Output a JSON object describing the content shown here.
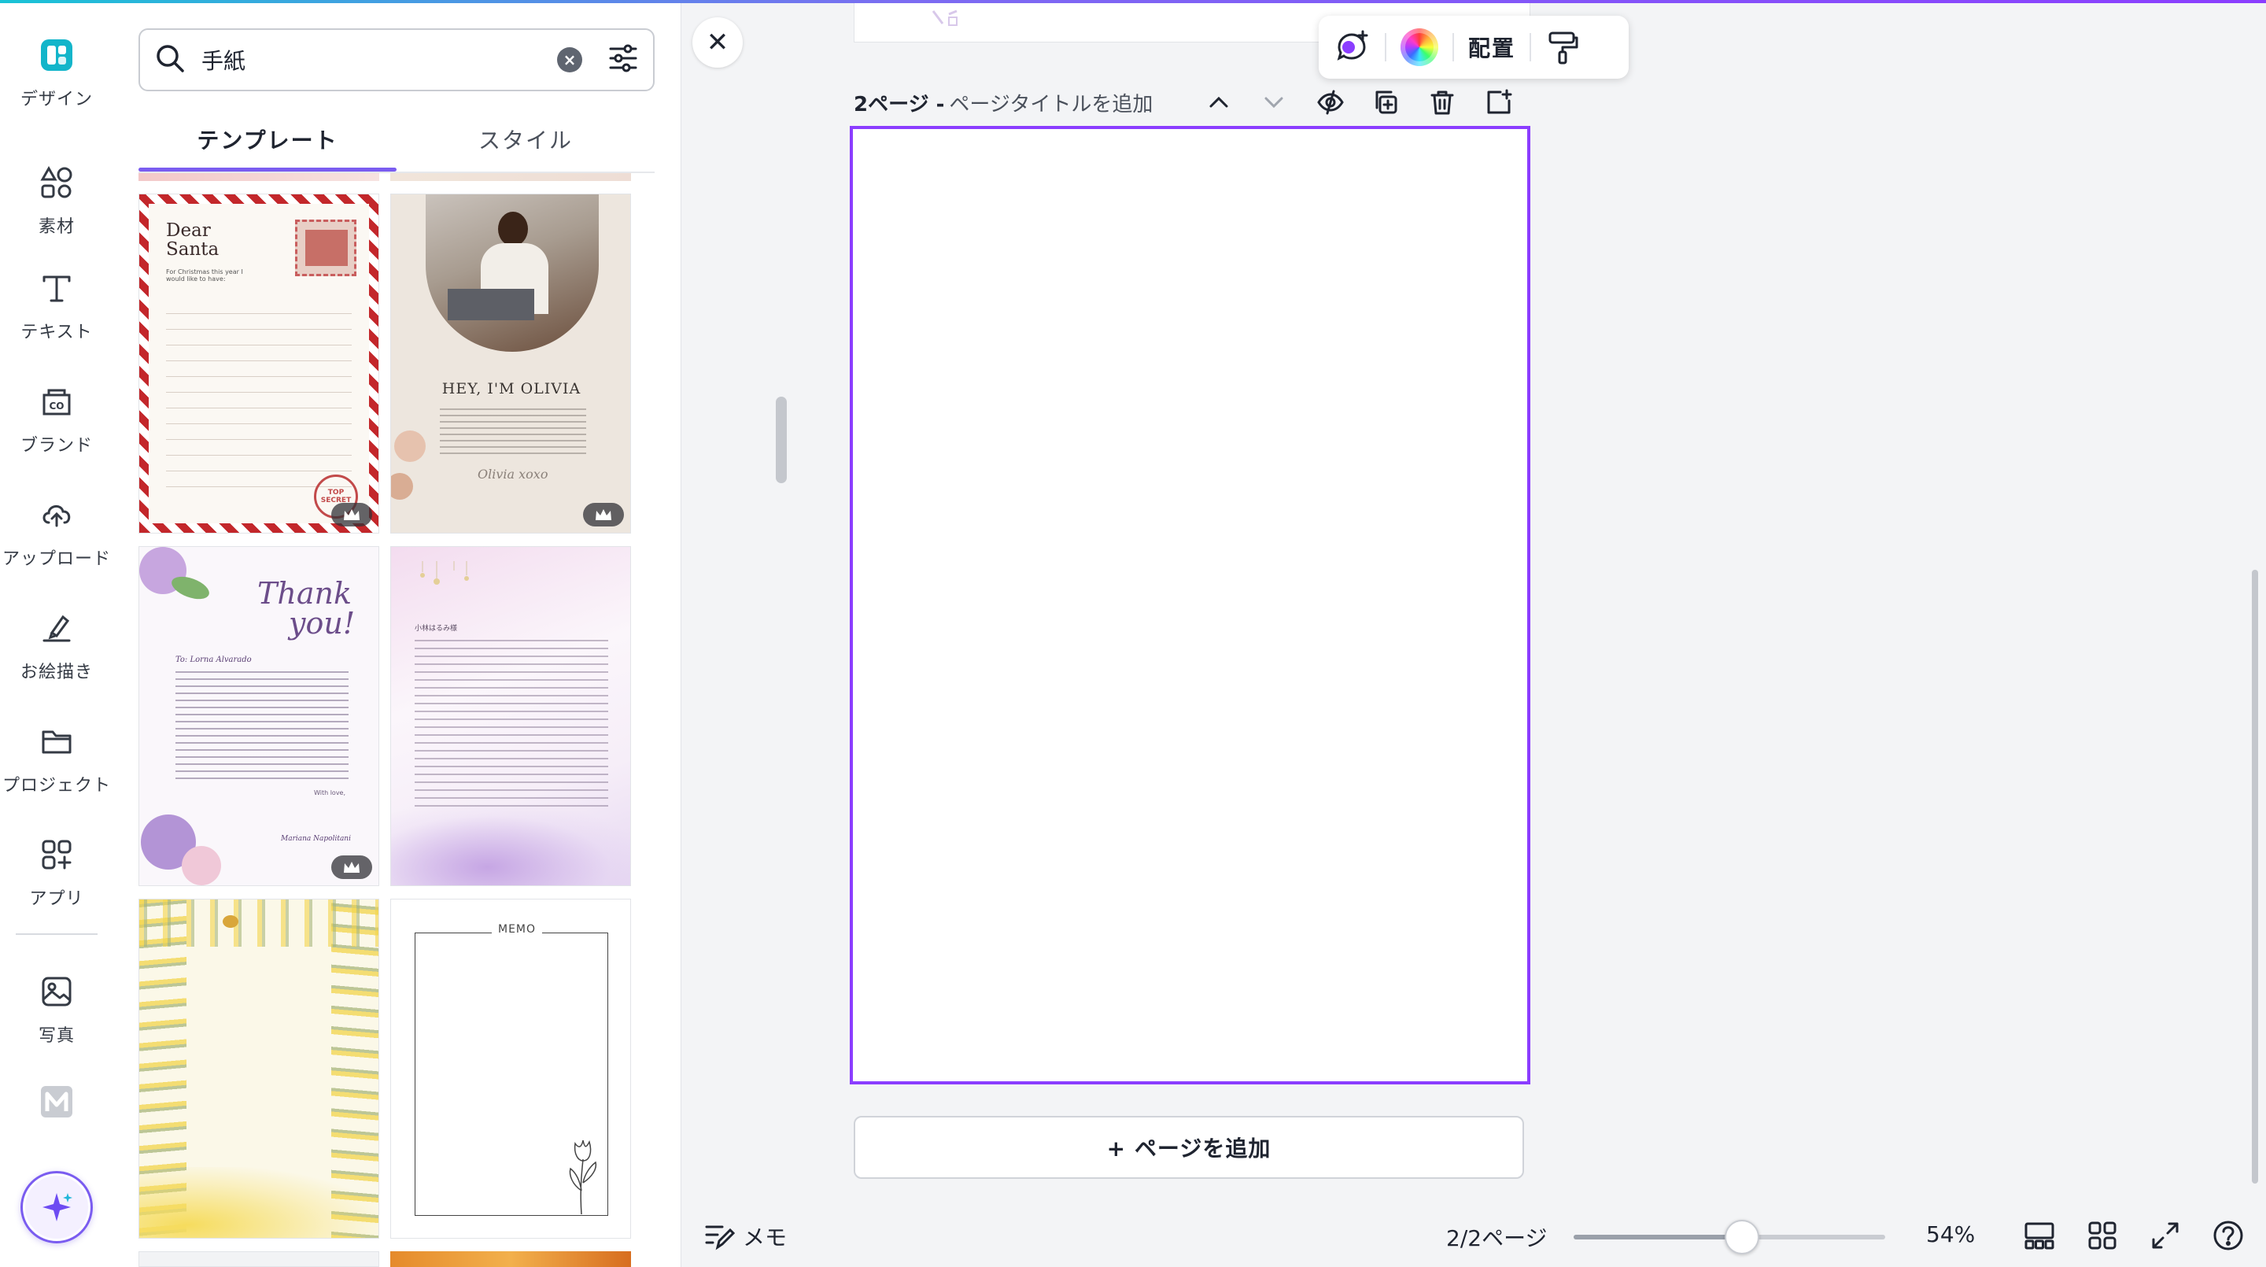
{
  "rail": {
    "items": [
      {
        "label": "デザイン",
        "icon": "design-icon"
      },
      {
        "label": "素材",
        "icon": "elements-icon"
      },
      {
        "label": "テキスト",
        "icon": "text-icon"
      },
      {
        "label": "ブランド",
        "icon": "brand-icon"
      },
      {
        "label": "アップロード",
        "icon": "upload-icon"
      },
      {
        "label": "お絵描き",
        "icon": "draw-icon"
      },
      {
        "label": "プロジェクト",
        "icon": "folder-icon"
      },
      {
        "label": "アプリ",
        "icon": "apps-icon"
      },
      {
        "label": "写真",
        "icon": "photo-icon"
      }
    ],
    "colors": {
      "accent": "#8b3dff",
      "design_tile": "#13b5ca"
    }
  },
  "panel": {
    "search_value": "手紙",
    "tabs": [
      {
        "label": "テンプレート",
        "active": true
      },
      {
        "label": "スタイル",
        "active": false
      }
    ]
  },
  "templates": [
    {
      "name": "dear-santa",
      "title_line1": "Dear",
      "title_line2": "Santa",
      "note": "For Christmas this year I would like to have:",
      "stamp": "TOP SECRET",
      "premium": true
    },
    {
      "name": "hey-im-olivia",
      "title": "HEY, I'M OLIVIA",
      "signature": "Olivia xoxo",
      "premium": true
    },
    {
      "name": "thank-you-floral",
      "title_line1": "Thank",
      "title_line2": "you!",
      "recipient": "To: Lorna Alvarado",
      "closing": "With love,",
      "sender": "Mariana Napolitani",
      "premium": true
    },
    {
      "name": "pastel-letter",
      "greeting": "小林はるみ様",
      "premium": false
    },
    {
      "name": "mimosa-frame",
      "premium": false
    },
    {
      "name": "memo-tulip",
      "title": "MEMO",
      "premium": false
    }
  ],
  "toolbar": {
    "arrange_label": "配置"
  },
  "page": {
    "number_label": "2ページ - ",
    "title_placeholder": "ページタイトルを追加",
    "add_page_label": "+ ページを追加",
    "border_color": "#8b3dff"
  },
  "footer": {
    "notes_label": "メモ",
    "page_count": "2/2ページ",
    "zoom_label": "54%",
    "zoom_level": 0.54
  }
}
